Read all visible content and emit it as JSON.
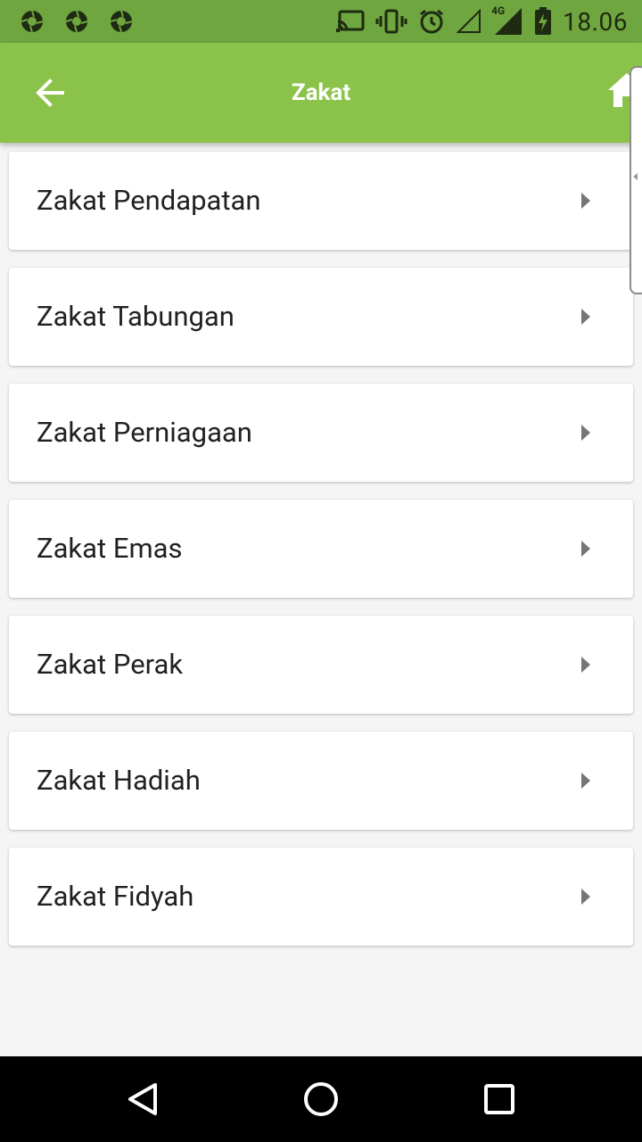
{
  "status_bar": {
    "time": "18.06",
    "network": "4G",
    "left_icons": [
      "aperture-icon",
      "aperture-icon",
      "aperture-icon"
    ],
    "right_icons": [
      "cast-icon",
      "vibrate-icon",
      "alarm-icon",
      "signal-empty-icon",
      "signal-4g-icon",
      "battery-charging-icon"
    ]
  },
  "app_bar": {
    "title": "Zakat",
    "color": "#8bc34a"
  },
  "menu_items": [
    {
      "label": "Zakat Pendapatan"
    },
    {
      "label": "Zakat Tabungan"
    },
    {
      "label": "Zakat Perniagaan"
    },
    {
      "label": "Zakat Emas"
    },
    {
      "label": "Zakat Perak"
    },
    {
      "label": "Zakat Hadiah"
    },
    {
      "label": "Zakat Fidyah"
    }
  ],
  "nav_bar": {
    "buttons": [
      "back-triangle-icon",
      "home-circle-icon",
      "recents-square-icon"
    ]
  }
}
